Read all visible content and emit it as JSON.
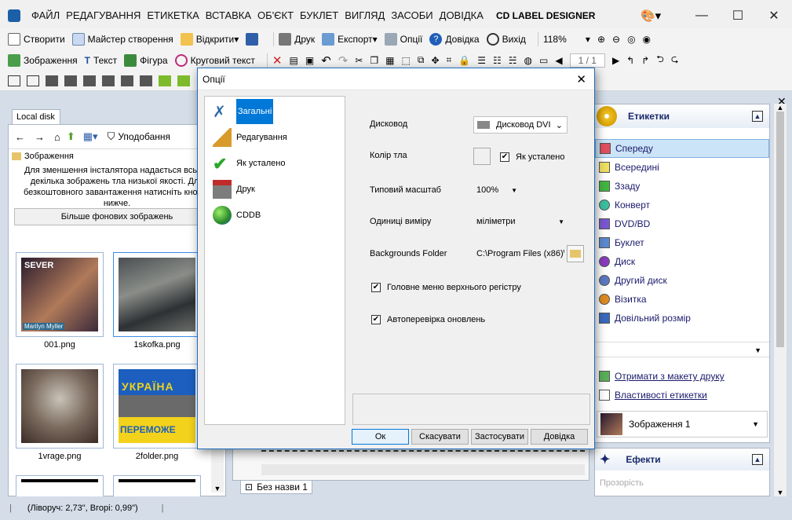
{
  "app": {
    "title": "CD LABEL DESIGNER",
    "menu": [
      "Файл",
      "Редагування",
      "Етикетка",
      "Вставка",
      "Об'єкт",
      "Буклет",
      "Вигляд",
      "Засоби",
      "Довідка"
    ]
  },
  "toolbar1": {
    "create": "Створити",
    "wizard": "Майстер створення",
    "open": "Відкрити",
    "print": "Друк",
    "export": "Експорт",
    "options": "Опції",
    "help": "Довідка",
    "exit": "Вихід",
    "zoom": "118%"
  },
  "toolbar2": {
    "image": "Зображення",
    "text": "Текст",
    "shape": "Фігура",
    "circular_text": "Круговий текст",
    "page_counter": "1 / 1"
  },
  "left_panel": {
    "tab": "Local disk",
    "favorites": "Уподобання",
    "folder": "Зображення",
    "notice": "Для зменшення інсталятора надається всього декілька зображень тла низької якості. Для безкоштовного завантаження натисніть кнопку нижче.",
    "more_button": "Більше фонових зображень",
    "thumbnails": [
      {
        "name": "001.png",
        "caption_line1": "SEVER",
        "caption_line2": "Marilyn Myller"
      },
      {
        "name": "1skofka.png"
      },
      {
        "name": "1vrage.png"
      },
      {
        "name": "2folder.png",
        "caption_line1": "УКРАЇНА",
        "caption_line2": "ПЕРЕМОЖЕ"
      }
    ]
  },
  "right_panel": {
    "labels_header": "Етикетки",
    "items": [
      "Спереду",
      "Всередині",
      "Ззаду",
      "Конверт",
      "DVD/BD",
      "Буклет",
      "Диск",
      "Другий диск",
      "Візитка",
      "Довільний розмір"
    ],
    "selected_index": 0,
    "get_from_layout": "Отримати з макету друку",
    "label_properties": "Властивості етикетки",
    "current_object": "Зображення 1",
    "effects_header": "Ефекти",
    "transparency": "Прозорість"
  },
  "canvas": {
    "tab_label": "Без назви 1"
  },
  "status": {
    "position": "(Ліворуч: 2,73\", Вгорі: 0,99\")"
  },
  "dialog": {
    "title": "Опції",
    "categories": [
      "Загальні",
      "Редагування",
      "Як усталено",
      "Друк",
      "CDDB"
    ],
    "selected_category": 0,
    "drive_label": "Дисковод",
    "drive_value": "Дисковод DVI",
    "bg_color_label": "Колір тла",
    "default_checkbox": "Як усталено",
    "default_checked": true,
    "zoom_label": "Типовий масштаб",
    "zoom_value": "100%",
    "units_label": "Одиниці виміру",
    "units_value": "міліметри",
    "bg_folder_label": "Backgrounds Folder",
    "bg_folder_value": "C:\\Program Files (x86)\\",
    "uppercase_menu": "Головне меню верхнього регістру",
    "uppercase_checked": true,
    "auto_update": "Автоперевірка оновлень",
    "auto_update_checked": true,
    "ok": "Ок",
    "cancel": "Скасувати",
    "apply": "Застосувати",
    "help": "Довідка"
  },
  "colors": {
    "accent": "#0078d7",
    "selection": "#cce4f7",
    "dialog_border": "#1c6fbf"
  }
}
